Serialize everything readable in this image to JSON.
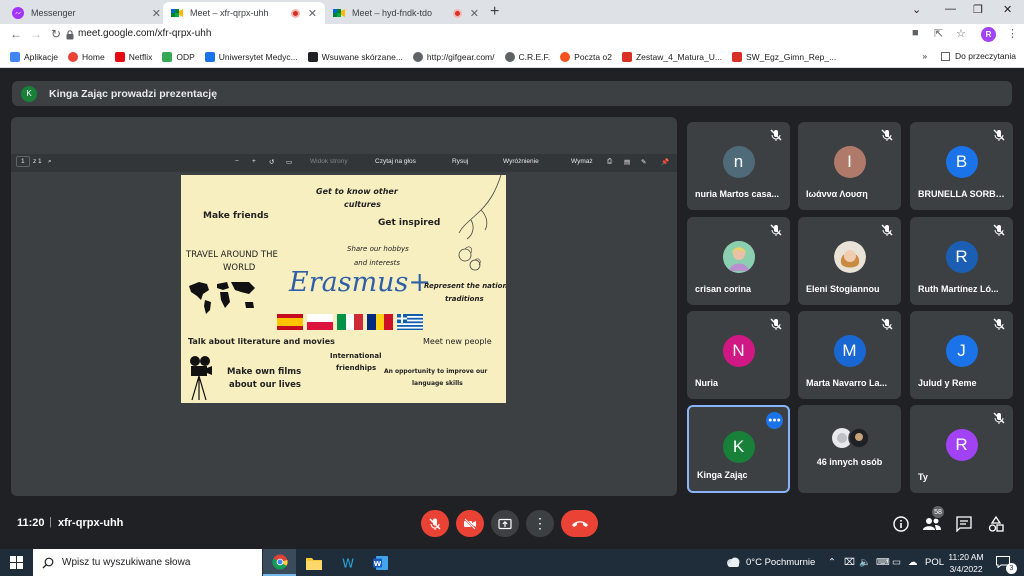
{
  "browser": {
    "tabs": [
      {
        "title": "Messenger",
        "active": false,
        "recording": false
      },
      {
        "title": "Meet – xfr-qrpx-uhh",
        "active": true,
        "recording": true
      },
      {
        "title": "Meet – hyd-fndk-tdo",
        "active": false,
        "recording": true
      }
    ],
    "url": "meet.google.com/xfr-qrpx-uhh",
    "profile_initial": "R",
    "bookmarks": [
      {
        "label": "Aplikacje",
        "color": "#4285f4"
      },
      {
        "label": "Home",
        "color": "#ea4335"
      },
      {
        "label": "Netflix",
        "color": "#e50914"
      },
      {
        "label": "ODP",
        "color": "#34a853"
      },
      {
        "label": "Uniwersytet Medyc...",
        "color": "#1a73e8"
      },
      {
        "label": "Wsuwane skórzane...",
        "color": "#202124"
      },
      {
        "label": "http://gifgear.com/",
        "color": "#5f6368"
      },
      {
        "label": "C.R.E.F.",
        "color": "#5f6368"
      },
      {
        "label": "Poczta o2",
        "color": "#f4511e"
      },
      {
        "label": "Zestaw_4_Matura_U...",
        "color": "#d93025"
      },
      {
        "label": "SW_Egz_Gimn_Rep_...",
        "color": "#d93025"
      }
    ],
    "bookmarks_overflow": "»",
    "reading_list": "Do przeczytania"
  },
  "meet": {
    "presenter_initial": "K",
    "presenter_banner": "Kinga Zając prowadzi prezentację",
    "pdf_toolbar": {
      "page": "1",
      "page_total": "z 1",
      "thumbnails": "Widok strony",
      "read_aloud": "Czytaj na głos",
      "draw": "Rysuj",
      "highlight": "Wyróżnienie",
      "erase": "Wymaż"
    },
    "slide": {
      "texts": {
        "friends": "Make friends",
        "cultures_1": "Get to know other",
        "cultures_2": "cultures",
        "inspired": "Get inspired",
        "travel_1": "TRAVEL AROUND THE",
        "travel_2": "WORLD",
        "hobbys_1": "Share our hobbys",
        "hobbys_2": "and interests",
        "erasmus": "Erasmus+",
        "represent_1": "Represent the national",
        "represent_2": "traditions",
        "literature": "Talk about literature and movies",
        "international_1": "International",
        "international_2": "friendhips",
        "new_people": "Meet new people",
        "films_1": "Make own films",
        "films_2": "about our lives",
        "opportunity_1": "An opportunity to improve our",
        "opportunity_2": "language skills"
      },
      "flags": [
        "spain",
        "poland",
        "italy",
        "romania",
        "greece"
      ]
    },
    "participants": [
      {
        "initial": "n",
        "name": "nuria Martos casa...",
        "color": "#4f6a78",
        "muted": true
      },
      {
        "initial": "I",
        "name": "Ιωάννα Λουση",
        "color": "#b07a6a",
        "muted": true
      },
      {
        "initial": "B",
        "name": "BRUNELLA SORBE...",
        "color": "#1a73e8",
        "muted": true
      },
      {
        "initial": "",
        "name": "crisan corina",
        "color": "#7fbf9f",
        "muted": true,
        "photo": true
      },
      {
        "initial": "",
        "name": "Eleni Stogiannou",
        "color": "#c9a27a",
        "muted": true,
        "photo": true
      },
      {
        "initial": "R",
        "name": "Ruth Martínez Ló...",
        "color": "#1a5fb4",
        "muted": true
      },
      {
        "initial": "N",
        "name": "Nuria",
        "color": "#d01884",
        "muted": true
      },
      {
        "initial": "M",
        "name": "Marta Navarro La...",
        "color": "#1967d2",
        "muted": true
      },
      {
        "initial": "J",
        "name": "Julud y Reme",
        "color": "#1a73e8",
        "muted": true
      },
      {
        "initial": "K",
        "name": "Kinga Zając",
        "color": "#188038",
        "speaking": true
      },
      {
        "initial": "",
        "name": "46 innych osób",
        "color": "#3c4043",
        "others": true
      },
      {
        "initial": "R",
        "name": "Ty",
        "color": "#a142f4",
        "muted": true
      }
    ],
    "time": "11:20",
    "separator": "|",
    "meeting_code": "xfr-qrpx-uhh",
    "participant_count": "58"
  },
  "taskbar": {
    "search_placeholder": "Wpisz tu wyszukiwane słowa",
    "weather": "0°C Pochmurnie",
    "language": "POL",
    "time": "11:20 AM",
    "date": "3/4/2022",
    "notifications": "3"
  }
}
